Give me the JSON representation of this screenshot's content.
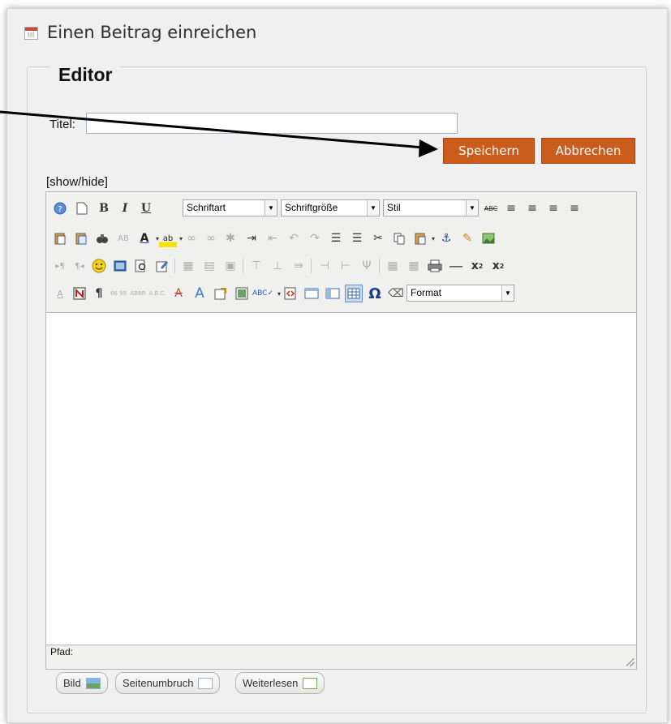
{
  "header": {
    "title": "Einen Beitrag einreichen",
    "icon": "calendar-icon"
  },
  "fieldset": {
    "legend": "Editor"
  },
  "form": {
    "title_label": "Titel:",
    "title_value": "",
    "save_label": "Speichern",
    "cancel_label": "Abbrechen",
    "accent_color": "#cc5c1c"
  },
  "editor": {
    "show_hide": "[show/hide]",
    "font_select": "Schriftart",
    "size_select": "Schriftgröße",
    "style_select": "Stil",
    "format_select": "Format",
    "path_label": "Pfad:"
  },
  "extra_buttons": {
    "image": "Bild",
    "pagebreak": "Seitenumbruch",
    "readmore": "Weiterlesen"
  }
}
